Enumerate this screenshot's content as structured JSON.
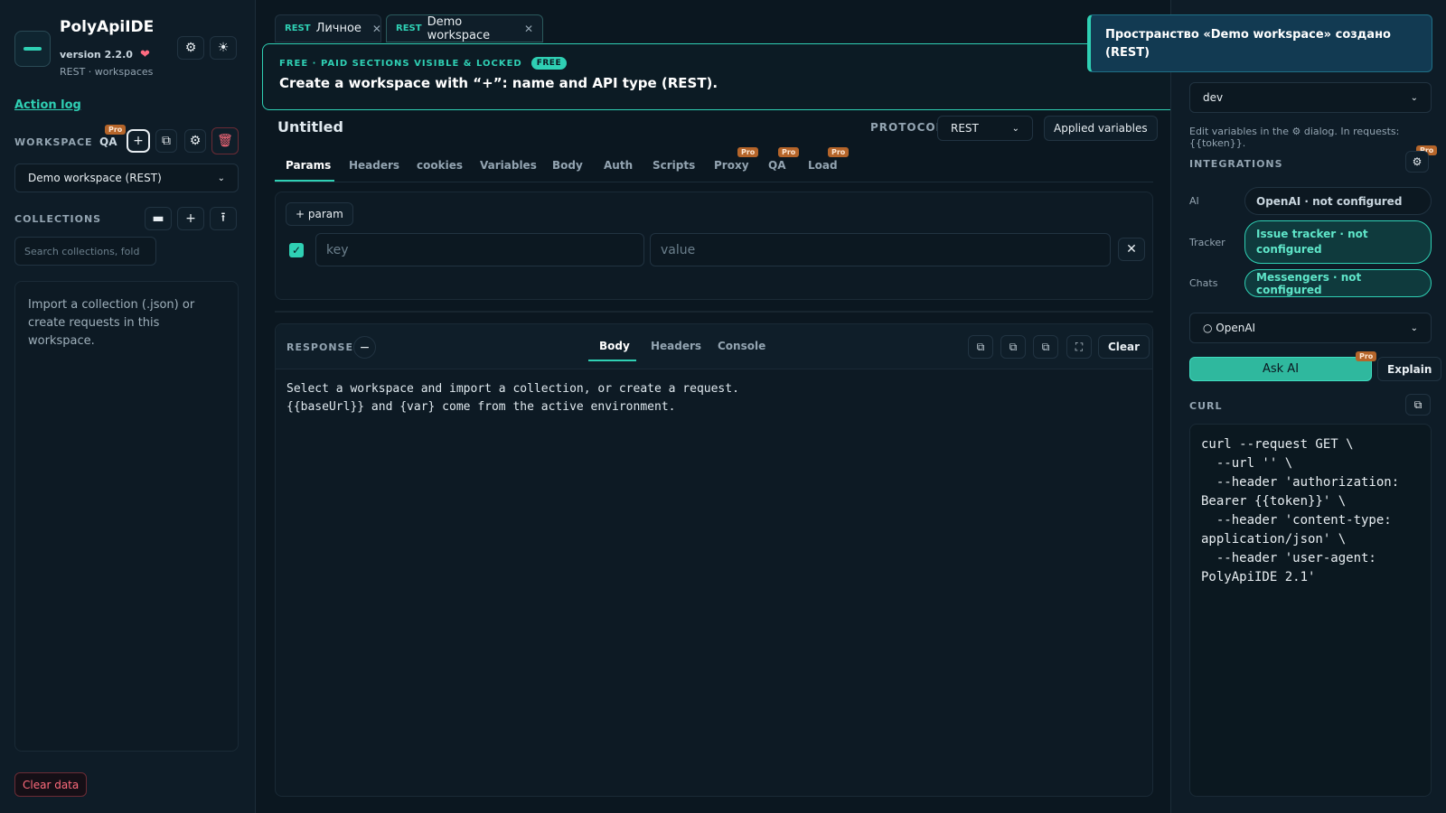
{
  "app": {
    "title": "PolyApiIDE",
    "version": "version 2.2.0",
    "subtitle": "REST · workspaces"
  },
  "sidebar": {
    "action_log": "Action log",
    "workspace_label": "WORKSPACE",
    "qa_label": "QA",
    "pro_badge": "Pro",
    "workspace_select": "Demo workspace (REST)",
    "collections_label": "COLLECTIONS",
    "search_placeholder": "Search collections, fold",
    "empty_text": "Import a collection (.json) or create requests in this workspace.",
    "clear_data": "Clear data"
  },
  "tabs": [
    {
      "kind": "REST",
      "label": "Личное"
    },
    {
      "kind": "REST",
      "label": "Demo workspace"
    }
  ],
  "banner": {
    "kicker": "FREE · PAID SECTIONS VISIBLE & LOCKED",
    "pill": "FREE",
    "message": "Create a workspace with “+”: name and API type (REST)."
  },
  "request": {
    "title": "Untitled",
    "protocol_label": "PROTOCOL",
    "protocol_value": "REST",
    "applied_vars": "Applied variables",
    "tabs": [
      "Params",
      "Headers",
      "cookies",
      "Variables",
      "Body",
      "Auth",
      "Scripts",
      "Proxy",
      "QA",
      "Load"
    ],
    "add_param": "+ param",
    "key_placeholder": "key",
    "value_placeholder": "value"
  },
  "response": {
    "label": "RESPONSE",
    "tabs": [
      "Body",
      "Headers",
      "Console"
    ],
    "clear": "Clear",
    "text": "Select a workspace and import a collection, or create a request.\n{{baseUrl}} and {var} come from the active environment."
  },
  "right": {
    "toast": "Пространство «Demo workspace» создано (REST)",
    "env_select": "dev",
    "hint": "Edit variables in the ⚙ dialog. In requests: {{token}}.",
    "integrations_label": "INTEGRATIONS",
    "ai_label": "AI",
    "ai_value": "OpenAI · not configured",
    "tracker_label": "Tracker",
    "tracker_value": "Issue tracker · not configured",
    "chats_label": "Chats",
    "chats_value": "Messengers · not configured",
    "provider_select": "○ OpenAI",
    "ask_ai": "Ask AI",
    "explain": "Explain",
    "curl_label": "CURL",
    "curl_text": "curl --request GET \\\n  --url '' \\\n  --header 'authorization: Bearer {{token}}' \\\n  --header 'content-type: application/json' \\\n  --header 'user-agent: PolyApiIDE 2.1'"
  },
  "colors": {
    "accent": "#2fd0b4",
    "danger": "#ff6b7c",
    "pro": "#b5652a",
    "bg": "#0b1720"
  }
}
